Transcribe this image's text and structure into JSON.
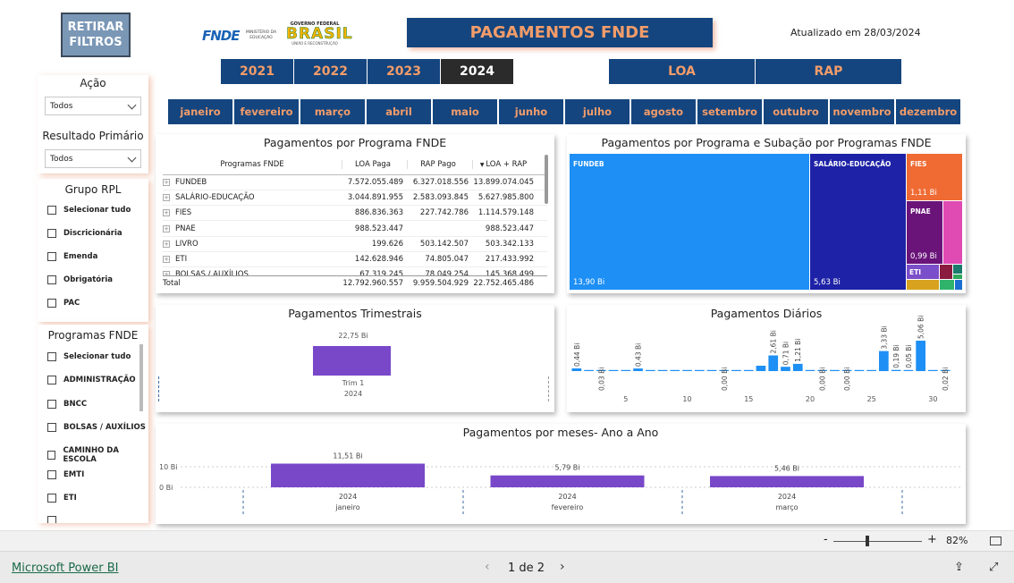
{
  "header": {
    "reset_button": "RETIRAR\nFILTROS",
    "logo_fnde": "FNDE",
    "ministry_text": "MINISTÉRIO DA EDUCAÇÃO",
    "brasil_text": "BRASIL",
    "brasil_top": "GOVERNO FEDERAL",
    "brasil_bottom": "UNIÃO E RECONSTRUÇÃO",
    "title": "PAGAMENTOS FNDE",
    "updated": "Atualizado em 28/03/2024"
  },
  "years": [
    "2021",
    "2022",
    "2023",
    "2024"
  ],
  "selected_year": "2024",
  "types": [
    "LOA",
    "RAP"
  ],
  "months": [
    "janeiro",
    "fevereiro",
    "março",
    "abril",
    "maio",
    "junho",
    "julho",
    "agosto",
    "setembro",
    "outubro",
    "novembro",
    "dezembro"
  ],
  "slicers": {
    "acao": {
      "title": "Ação",
      "value": "Todos"
    },
    "resultado": {
      "title": "Resultado Primário",
      "value": "Todos"
    },
    "grupo_rpl": {
      "title": "Grupo RPL",
      "items": [
        "Selecionar tudo",
        "Discricionária",
        "Emenda",
        "Obrigatória",
        "PAC"
      ]
    },
    "programas": {
      "title": "Programas FNDE",
      "items": [
        "Selecionar tudo",
        "ADMINISTRAÇÃO",
        "BNCC",
        "BOLSAS / AUXÍLIOS",
        "CAMINHO DA ESCOLA",
        "EMTI",
        "ETI"
      ]
    }
  },
  "table": {
    "title": "Pagamentos por Programa FNDE",
    "headers": [
      "Programas FNDE",
      "LOA Paga",
      "RAP Pago",
      "LOA + RAP"
    ],
    "rows": [
      [
        "FUNDEB",
        "7.572.055.489",
        "6.327.018.556",
        "13.899.074.045"
      ],
      [
        "SALÁRIO-EDUCAÇÃO",
        "3.044.891.955",
        "2.583.093.845",
        "5.627.985.800"
      ],
      [
        "FIES",
        "886.836.363",
        "227.742.786",
        "1.114.579.148"
      ],
      [
        "PNAE",
        "988.523.447",
        "",
        "988.523.447"
      ],
      [
        "LIVRO",
        "199.626",
        "503.142.507",
        "503.342.133"
      ],
      [
        "ETI",
        "142.628.946",
        "74.805.047",
        "217.433.992"
      ],
      [
        "BOLSAS / AUXÍLIOS",
        "67.319.245",
        "78.049.254",
        "145.368.499"
      ]
    ],
    "total": [
      "Total",
      "12.792.960.557",
      "9.959.504.929",
      "22.752.465.486"
    ]
  },
  "treemap": {
    "title": "Pagamentos por Programa e Subação por Programas FNDE",
    "blocks": [
      {
        "name": "FUNDEB",
        "label": "FUNDEB",
        "value": "13,90 Bi",
        "color": "#1e8ff5"
      },
      {
        "name": "SALARIO",
        "label": "SALÁRIO-EDUCAÇÃO",
        "value": "5,63 Bi",
        "color": "#1d22a6"
      },
      {
        "name": "FIES",
        "label": "FIES",
        "value": "1,11 Bi",
        "color": "#ef6b33"
      },
      {
        "name": "PNAE",
        "label": "PNAE",
        "value": "0,99 Bi",
        "color": "#6a147a"
      },
      {
        "name": "ETI",
        "label": "ETI",
        "value": "",
        "color": "#7b4fc9"
      }
    ]
  },
  "quarterly": {
    "title": "Pagamentos Trimestrais",
    "value_label": "22,75 Bi",
    "category": "Trim 1",
    "year": "2024"
  },
  "daily": {
    "title": "Pagamentos Diários",
    "ticks": [
      "5",
      "10",
      "15",
      "20",
      "25",
      "30"
    ],
    "labels": [
      {
        "day": 1,
        "text": "0,44 Bi"
      },
      {
        "day": 3,
        "text": "0,03 Bi"
      },
      {
        "day": 6,
        "text": "0,43 Bi"
      },
      {
        "day": 13,
        "text": "0,00 Bi"
      },
      {
        "day": 17,
        "text": "2,61 Bi"
      },
      {
        "day": 18,
        "text": "0,71 Bi"
      },
      {
        "day": 19,
        "text": "1,21 Bi"
      },
      {
        "day": 21,
        "text": "0,00 Bi"
      },
      {
        "day": 23,
        "text": "0,00 Bi"
      },
      {
        "day": 26,
        "text": "3,33 Bi"
      },
      {
        "day": 27,
        "text": "0,19 Bi"
      },
      {
        "day": 28,
        "text": "0,05 Bi"
      },
      {
        "day": 29,
        "text": "5,06 Bi"
      },
      {
        "day": 31,
        "text": "0,02 Bi"
      }
    ]
  },
  "monthly": {
    "title": "Pagamentos por meses- Ano a Ano",
    "y_ticks": [
      "10 Bi",
      "0 Bi"
    ],
    "bars": [
      {
        "label": "11,51 Bi",
        "year": "2024",
        "month": "janeiro"
      },
      {
        "label": "5,79 Bi",
        "year": "2024",
        "month": "fevereiro"
      },
      {
        "label": "5,46 Bi",
        "year": "2024",
        "month": "março"
      }
    ]
  },
  "chart_data": [
    {
      "type": "bar",
      "title": "Pagamentos Trimestrais",
      "categories": [
        "Trim 1"
      ],
      "values": [
        22.75
      ]
    },
    {
      "type": "bar",
      "title": "Pagamentos Diários",
      "x": [
        1,
        2,
        3,
        4,
        5,
        6,
        7,
        8,
        9,
        10,
        11,
        12,
        13,
        14,
        15,
        16,
        17,
        18,
        19,
        20,
        21,
        22,
        23,
        24,
        25,
        26,
        27,
        28,
        29,
        30,
        31
      ],
      "values": [
        0.44,
        0.05,
        0.03,
        0.05,
        0.05,
        0.43,
        0.05,
        0.05,
        0.05,
        0.05,
        0.05,
        0.05,
        0.0,
        0.05,
        0.05,
        0.9,
        2.61,
        0.71,
        1.21,
        0.05,
        0.0,
        0.05,
        0.0,
        0.05,
        0.05,
        3.33,
        0.19,
        0.05,
        5.06,
        0.05,
        0.02
      ]
    },
    {
      "type": "bar",
      "title": "Pagamentos por meses- Ano a Ano",
      "categories": [
        "janeiro",
        "fevereiro",
        "março"
      ],
      "values": [
        11.51,
        5.79,
        5.46
      ],
      "ylim": [
        0,
        13
      ]
    }
  ],
  "footer": {
    "brand": "Microsoft Power BI",
    "page": "1 de 2",
    "zoom": "82%",
    "zoom_minus": "-",
    "zoom_plus": "+"
  }
}
